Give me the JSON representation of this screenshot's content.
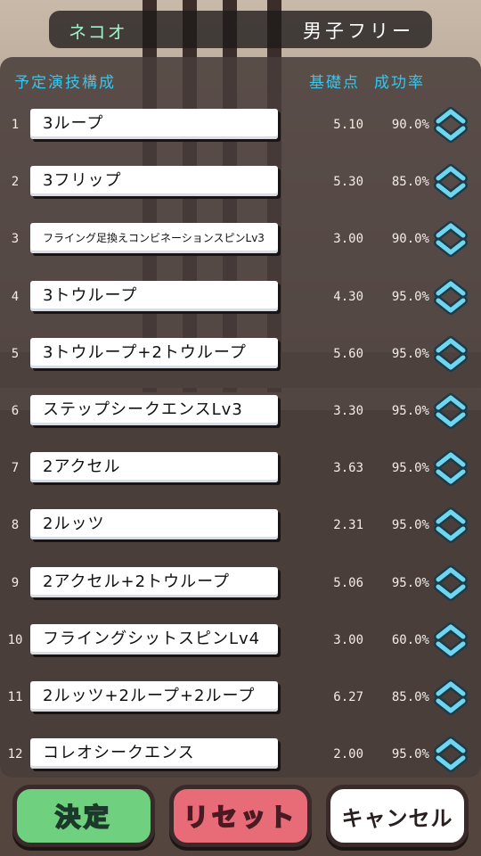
{
  "header": {
    "player": "ネコオ",
    "program": "男子フリー"
  },
  "columns": {
    "planned": "予定演技構成",
    "base": "基礎点",
    "rate": "成功率"
  },
  "elements": [
    {
      "num": "1",
      "name": "3ループ",
      "base": "5.10",
      "rate": "90.0%"
    },
    {
      "num": "2",
      "name": "3フリップ",
      "base": "5.30",
      "rate": "85.0%"
    },
    {
      "num": "3",
      "name": "フライング足換えコンビネーションスピンLv3",
      "base": "3.00",
      "rate": "90.0%"
    },
    {
      "num": "4",
      "name": "3トウループ",
      "base": "4.30",
      "rate": "95.0%"
    },
    {
      "num": "5",
      "name": "3トウループ+2トウループ",
      "base": "5.60",
      "rate": "95.0%"
    },
    {
      "num": "6",
      "name": "ステップシークエンスLv3",
      "base": "3.30",
      "rate": "95.0%"
    },
    {
      "num": "7",
      "name": "2アクセル",
      "base": "3.63",
      "rate": "95.0%"
    },
    {
      "num": "8",
      "name": "2ルッツ",
      "base": "2.31",
      "rate": "95.0%"
    },
    {
      "num": "9",
      "name": "2アクセル+2トウループ",
      "base": "5.06",
      "rate": "95.0%"
    },
    {
      "num": "10",
      "name": "フライングシットスピンLv4",
      "base": "3.00",
      "rate": "60.0%"
    },
    {
      "num": "11",
      "name": "2ルッツ+2ループ+2ループ",
      "base": "6.27",
      "rate": "85.0%"
    },
    {
      "num": "12",
      "name": "コレオシークエンス",
      "base": "2.00",
      "rate": "95.0%"
    }
  ],
  "buttons": {
    "decide": "決定",
    "reset": "リセット",
    "cancel": "キャンセル"
  },
  "icons": {
    "reorder": "reorder-chevrons-icon"
  },
  "colors": {
    "accent": "#35c6f0",
    "player": "#9ff0c8",
    "ok": "#6fd07f",
    "reset": "#e86b78"
  }
}
